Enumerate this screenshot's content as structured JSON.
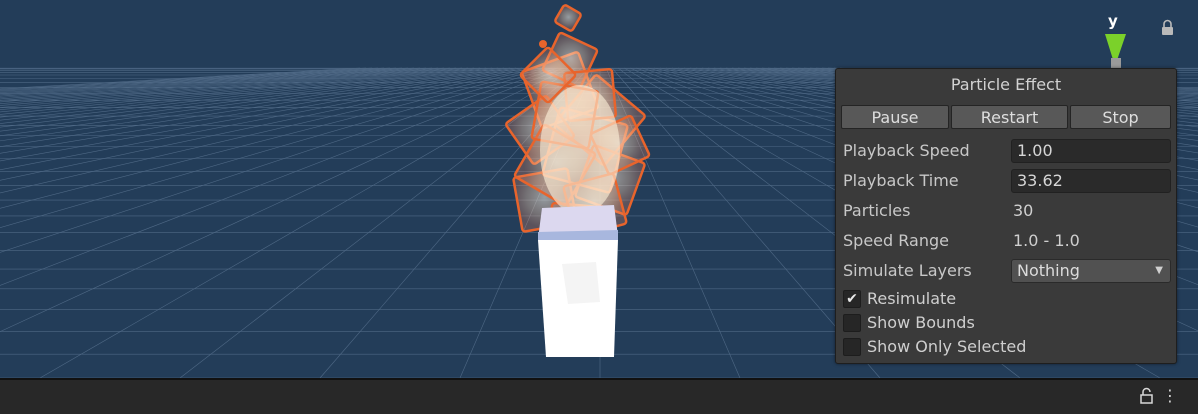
{
  "gizmo": {
    "axis_label": "y"
  },
  "particle_panel": {
    "title": "Particle Effect",
    "buttons": {
      "pause": "Pause",
      "restart": "Restart",
      "stop": "Stop"
    },
    "playback_speed": {
      "label": "Playback Speed",
      "value": "1.00"
    },
    "playback_time": {
      "label": "Playback Time",
      "value": "33.62"
    },
    "particles": {
      "label": "Particles",
      "value": "30"
    },
    "speed_range": {
      "label": "Speed Range",
      "value": "1.0 - 1.0"
    },
    "simulate_layers": {
      "label": "Simulate Layers",
      "value": "Nothing"
    },
    "resimulate": {
      "label": "Resimulate",
      "checked": true
    },
    "show_bounds": {
      "label": "Show Bounds",
      "checked": false
    },
    "show_only_selected": {
      "label": "Show Only Selected",
      "checked": false
    }
  },
  "colors": {
    "sky": "#233d59",
    "grid": "#5d7794",
    "flame_edge": "#e8642c",
    "flame_core": "#fff2da",
    "panel": "#3a3a3a"
  }
}
